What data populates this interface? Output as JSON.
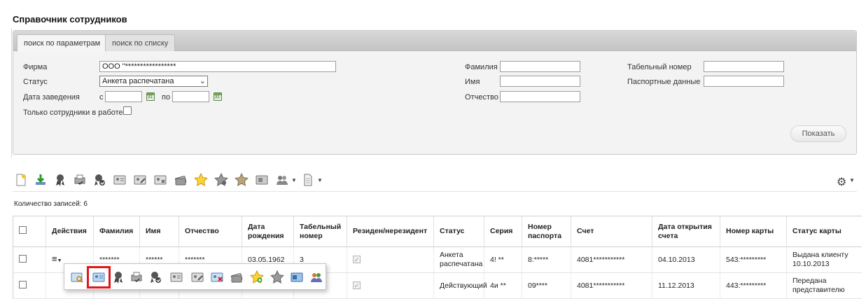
{
  "page": {
    "title": "Справочник сотрудников"
  },
  "tabs": [
    {
      "label": "поиск по параметрам"
    },
    {
      "label": "поиск по списку"
    }
  ],
  "filters": {
    "firm_label": "Фирма",
    "firm_value": "ООО \"*****************",
    "status_label": "Статус",
    "status_value": "Анкета распечатана",
    "date_label": "Дата заведения",
    "date_from_label": "с",
    "date_to_label": "по",
    "only_working_label": "Только сотрудники в работе",
    "lastname_label": "Фамилия",
    "firstname_label": "Имя",
    "middlename_label": "Отчество",
    "tabnum_label": "Табельный номер",
    "passport_label": "Паспортные данные",
    "show_button": "Показать"
  },
  "records": {
    "count_label": "Количество записей: 6"
  },
  "table": {
    "headers": [
      "Действия",
      "Фамилия",
      "Имя",
      "Отчество",
      "Дата рождения",
      "Табельный номер",
      "Резиден/нерезидент",
      "Статус",
      "Серия",
      "Номер паспорта",
      "Счет",
      "Дата открытия счета",
      "Номер карты",
      "Статус карты"
    ],
    "rows": [
      {
        "lastname": "*******",
        "firstname": "******",
        "middlename": "*******",
        "birth": "03.05.1962",
        "tabnum": "3",
        "status": "Анкета распечатана",
        "series": "4! **",
        "passport": "8:*****",
        "account": "4081***********",
        "opened": "04.10.2013",
        "card": "543:*********",
        "card_status": "Выдана клиенту 10.10.2013"
      },
      {
        "lastname": "",
        "firstname": "",
        "middlename": "",
        "birth": "",
        "tabnum": "",
        "status": "Действующий",
        "series": "4и **",
        "passport": "09****",
        "account": "4081***********",
        "opened": "11.12.2013",
        "card": "443:*********",
        "card_status": "Передана представителю"
      }
    ]
  },
  "icons": {
    "toolbar": [
      "new-document-icon",
      "download-icon",
      "award-icon",
      "printer-check-icon",
      "award-check-icon",
      "id-card-icon",
      "id-card-edit-icon",
      "id-card-delete-icon",
      "card-stack-icon",
      "star-icon",
      "star-gray-icon",
      "star-gold-icon",
      "document-icon",
      "users-group-icon",
      "page-icon"
    ],
    "popup": [
      "id-card-search-icon",
      "id-card-icon",
      "award-icon",
      "printer-check-icon",
      "award-check-icon",
      "id-card-gray-icon",
      "id-card-edit-icon",
      "id-card-delete-icon",
      "card-stack-icon",
      "star-add-icon",
      "star-gray-icon",
      "id-card-blue-icon",
      "users-group-icon"
    ]
  },
  "colors": {
    "highlight": "#e0161a",
    "panel": "#f3f3f3",
    "tab_bar": "#cfcfcf"
  }
}
